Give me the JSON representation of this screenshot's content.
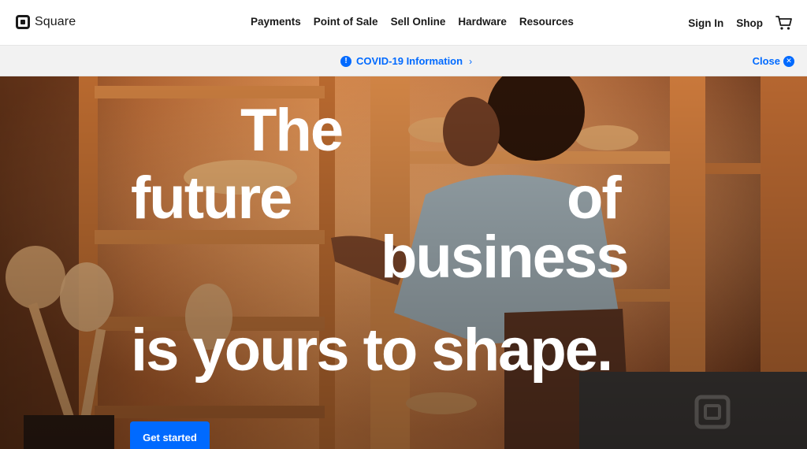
{
  "brand": {
    "name": "Square"
  },
  "nav": {
    "items": [
      {
        "label": "Payments"
      },
      {
        "label": "Point of Sale"
      },
      {
        "label": "Sell Online"
      },
      {
        "label": "Hardware"
      },
      {
        "label": "Resources"
      }
    ],
    "sign_in": "Sign In",
    "shop": "Shop",
    "cart_icon": "cart-icon"
  },
  "alert": {
    "text": "COVID-19 Information",
    "chevron": "›",
    "icon": "info-icon",
    "close_label": "Close",
    "close_icon": "close-icon"
  },
  "hero": {
    "words": {
      "the": "The",
      "future": "future",
      "of": "of",
      "business": "business",
      "shape": "is yours to shape."
    },
    "cta_label": "Get started"
  },
  "colors": {
    "accent": "#006aff",
    "text": "#1a1a1a",
    "alert_bg": "#f2f2f2"
  }
}
